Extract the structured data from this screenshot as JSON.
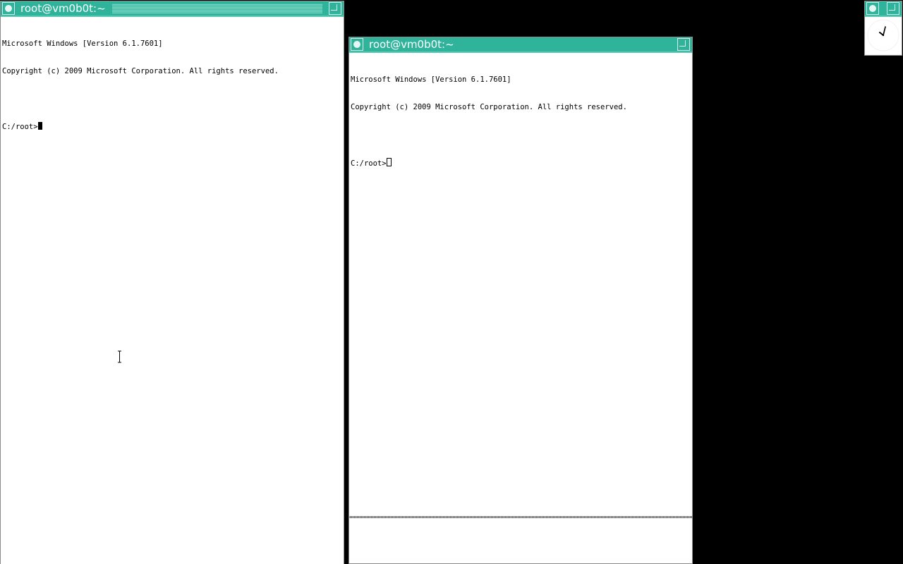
{
  "windows": {
    "left_terminal": {
      "title": "root@vm0b0t:~",
      "lines": {
        "l1": "Microsoft Windows [Version 6.1.7601]",
        "l2": "Copyright (c) 2009 Microsoft Corporation. All rights reserved.",
        "prompt": "C:/root>"
      }
    },
    "right_terminal": {
      "title": "root@vm0b0t:~",
      "lines": {
        "l1": "Microsoft Windows [Version 6.1.7601]",
        "l2": "Copyright (c) 2009 Microsoft Corporation. All rights reserved.",
        "prompt": "C:/root>"
      }
    }
  },
  "icons": {
    "window_menu": "circle-menu-icon",
    "window_resize": "resize-icon",
    "clock": "analog-clock-icon",
    "text_cursor": "ibeam-cursor-icon"
  },
  "colors": {
    "titlebar": "#2fb39b",
    "desktop": "#000000",
    "terminal_bg": "#ffffff",
    "terminal_fg": "#000000"
  }
}
